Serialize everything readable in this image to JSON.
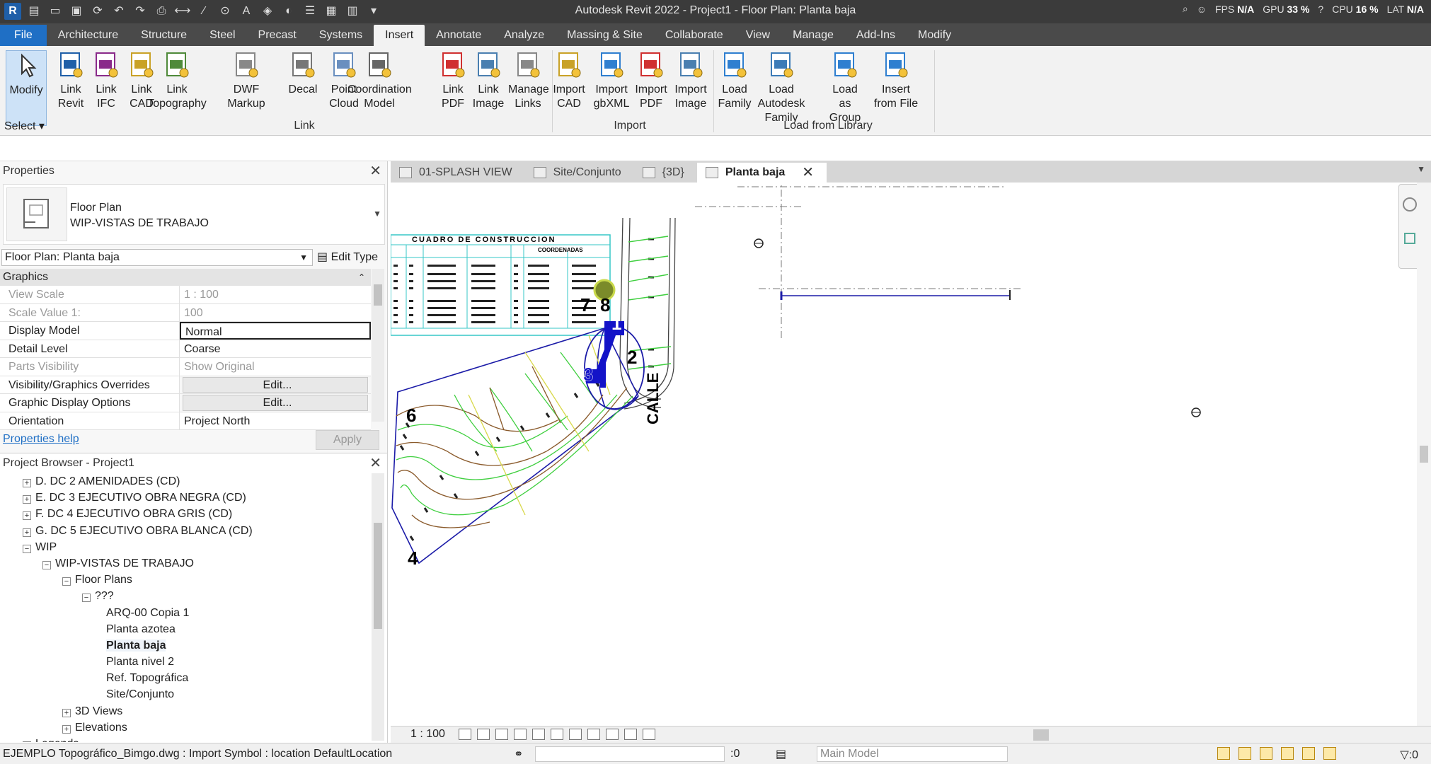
{
  "window": {
    "title": "Autodesk Revit 2022 - Project1 - Floor Plan: Planta baja",
    "fps_label": "FPS",
    "fps_value": "N/A",
    "gpu_label": "GPU",
    "gpu_value": "33 %",
    "cpu_label": "CPU",
    "cpu_value": "16 %",
    "lat_label": "LAT",
    "lat_value": "N/A"
  },
  "ribbon_tabs": [
    "File",
    "Architecture",
    "Structure",
    "Steel",
    "Precast",
    "Systems",
    "Insert",
    "Annotate",
    "Analyze",
    "Massing & Site",
    "Collaborate",
    "View",
    "Manage",
    "Add-Ins",
    "Modify"
  ],
  "active_tab": "Insert",
  "ribbon": {
    "modify": "Modify",
    "select": "Select",
    "link_group": "Link",
    "import_group": "Import",
    "library_group": "Load from Library",
    "buttons": [
      {
        "l1": "Link",
        "l2": "Revit",
        "icon": "rvt"
      },
      {
        "l1": "Link",
        "l2": "IFC",
        "icon": "ifc"
      },
      {
        "l1": "Link",
        "l2": "CAD",
        "icon": "cad"
      },
      {
        "l1": "Link",
        "l2": "Topography",
        "icon": "topo"
      },
      {
        "l1": "DWF",
        "l2": "Markup",
        "icon": "dwf"
      },
      {
        "l1": "Decal",
        "l2": "",
        "icon": "decal"
      },
      {
        "l1": "Point",
        "l2": "Cloud",
        "icon": "cloud"
      },
      {
        "l1": "Coordination",
        "l2": "Model",
        "icon": "coord"
      },
      {
        "l1": "Link",
        "l2": "PDF",
        "icon": "pdf"
      },
      {
        "l1": "Link",
        "l2": "Image",
        "icon": "image"
      },
      {
        "l1": "Manage",
        "l2": "Links",
        "icon": "links"
      },
      {
        "l1": "Import",
        "l2": "CAD",
        "icon": "cad"
      },
      {
        "l1": "Import",
        "l2": "gbXML",
        "icon": "xml"
      },
      {
        "l1": "Import",
        "l2": "PDF",
        "icon": "pdf"
      },
      {
        "l1": "Import",
        "l2": "Image",
        "icon": "image"
      },
      {
        "l1": "Load",
        "l2": "Family",
        "icon": "family"
      },
      {
        "l1": "Load Autodesk",
        "l2": "Family",
        "icon": "adsk"
      },
      {
        "l1": "Load as",
        "l2": "Group",
        "icon": "group"
      },
      {
        "l1": "Insert",
        "l2": "from File",
        "icon": "file"
      }
    ]
  },
  "properties": {
    "title": "Properties",
    "type_name": "Floor Plan",
    "type_sub": "WIP-VISTAS DE TRABAJO",
    "instance": "Floor Plan: Planta baja",
    "edit_type": "Edit Type",
    "category": "Graphics",
    "rows": [
      {
        "k": "View Scale",
        "v": "1 : 100",
        "dim": true
      },
      {
        "k": "Scale Value    1:",
        "v": "100",
        "dim": true
      },
      {
        "k": "Display Model",
        "v": "Normal",
        "dim": false,
        "boxed": true
      },
      {
        "k": "Detail Level",
        "v": "Coarse",
        "dim": false
      },
      {
        "k": "Parts Visibility",
        "v": "Show Original",
        "dim": true
      },
      {
        "k": "Visibility/Graphics Overrides",
        "v": "Edit...",
        "dim": false,
        "btn": true
      },
      {
        "k": "Graphic Display Options",
        "v": "Edit...",
        "dim": false,
        "btn": true
      },
      {
        "k": "Orientation",
        "v": "Project North",
        "dim": false
      }
    ],
    "help": "Properties help",
    "apply": "Apply"
  },
  "browser": {
    "title": "Project Browser - Project1",
    "nodes": [
      {
        "label": "D. DC 2 AMENIDADES (CD)",
        "level": 1,
        "toggle": "+"
      },
      {
        "label": "E. DC 3 EJECUTIVO OBRA NEGRA (CD)",
        "level": 1,
        "toggle": "+"
      },
      {
        "label": "F. DC 4 EJECUTIVO OBRA GRIS (CD)",
        "level": 1,
        "toggle": "+"
      },
      {
        "label": "G. DC 5 EJECUTIVO OBRA BLANCA (CD)",
        "level": 1,
        "toggle": "+"
      },
      {
        "label": "WIP",
        "level": 1,
        "toggle": "−"
      },
      {
        "label": "WIP-VISTAS DE TRABAJO",
        "level": 2,
        "toggle": "−"
      },
      {
        "label": "Floor Plans",
        "level": 3,
        "toggle": "−"
      },
      {
        "label": "???",
        "level": 4,
        "toggle": "−"
      },
      {
        "label": "ARQ-00 Copia 1",
        "level": 5,
        "toggle": ""
      },
      {
        "label": "Planta azotea",
        "level": 5,
        "toggle": ""
      },
      {
        "label": "Planta baja",
        "level": 5,
        "toggle": "",
        "bold": true
      },
      {
        "label": "Planta nivel 2",
        "level": 5,
        "toggle": ""
      },
      {
        "label": "Ref. Topográfica",
        "level": 5,
        "toggle": ""
      },
      {
        "label": "Site/Conjunto",
        "level": 5,
        "toggle": ""
      },
      {
        "label": "3D Views",
        "level": 3,
        "toggle": "+"
      },
      {
        "label": "Elevations",
        "level": 3,
        "toggle": "+"
      },
      {
        "label": "Legends",
        "level": 1,
        "toggle": "+"
      }
    ]
  },
  "view_tabs": [
    {
      "label": "01-SPLASH VIEW",
      "active": false
    },
    {
      "label": "Site/Conjunto",
      "active": false
    },
    {
      "label": "{3D}",
      "active": false
    },
    {
      "label": "Planta baja",
      "active": true
    }
  ],
  "canvas": {
    "table_title": "CUADRO DE CONSTRUCCION",
    "table_sub": "COORDENADAS",
    "street_label": "CALLE",
    "vertex_labels": [
      "1",
      "2",
      "3",
      "4",
      "6",
      "7",
      "8"
    ]
  },
  "view_control": {
    "scale": "1 : 100"
  },
  "statusbar": {
    "text": "EJEMPLO Topográfico_Bimgo.dwg : Import Symbol : location DefaultLocation",
    "worksets": ":0",
    "model": "Main Model",
    "filter": ":0"
  },
  "colors": {
    "boundary": "#1c1ca8",
    "contour_green": "#3fcf3f",
    "contour_brown": "#8a5a2b",
    "accent_blue": "#1f6fc5"
  }
}
